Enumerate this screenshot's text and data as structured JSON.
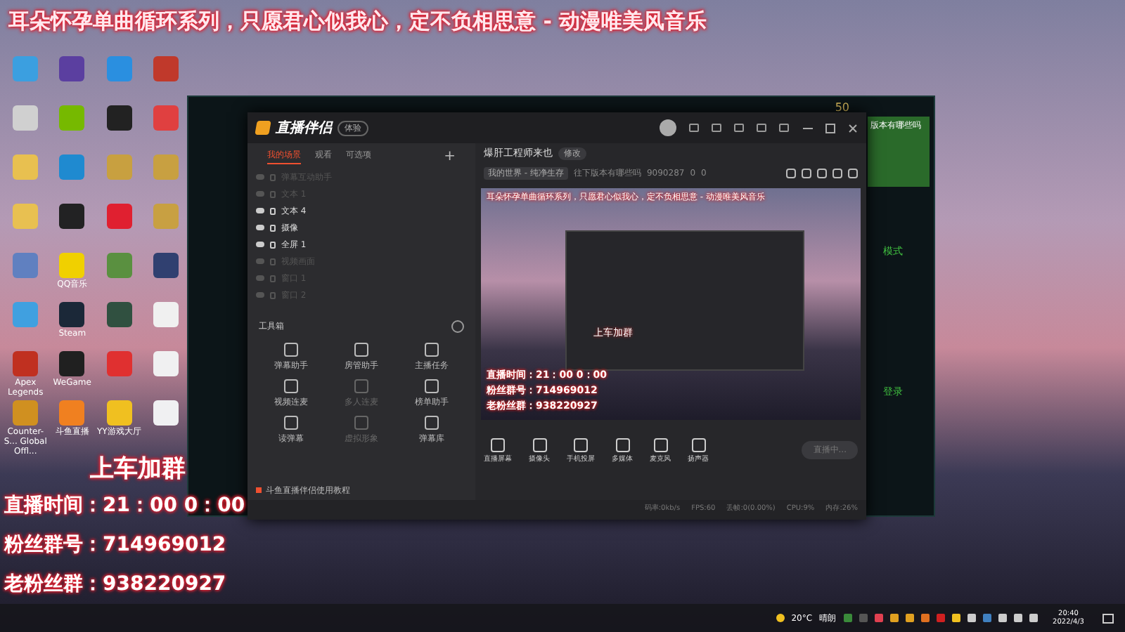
{
  "overlay": {
    "banner": "耳朵怀孕单曲循环系列，只愿君心似我心，定不负相思意 - 动漫唯美风音乐",
    "join": "上车加群",
    "lines": [
      "直播时间：21：00 0：00",
      "粉丝群号：714969012",
      "老粉丝群：938220927"
    ]
  },
  "desktop_icons": [
    {
      "color": "#3b9fe0"
    },
    {
      "color": "#5b3fa0"
    },
    {
      "color": "#2a8fe0"
    },
    {
      "color": "#c0392b"
    },
    {
      "color": "#d0d0d0"
    },
    {
      "color": "#76b900"
    },
    {
      "color": "#222222"
    },
    {
      "color": "#e04040"
    },
    {
      "color": "#e8c050"
    },
    {
      "color": "#1f8ad0"
    },
    {
      "color": "#c8a040"
    },
    {
      "color": "#c8a041"
    },
    {
      "color": "#e8c051"
    },
    {
      "color": "#222223"
    },
    {
      "color": "#e02030"
    },
    {
      "color": "#c8a042"
    },
    {
      "color": "#6080c0"
    },
    {
      "label": "QQ音乐",
      "color": "#f0d000"
    },
    {
      "color": "#5a9040"
    },
    {
      "color": "#304070"
    },
    {
      "color": "#40a0e0"
    },
    {
      "label": "Steam",
      "color": "#1b2838"
    },
    {
      "color": "#305040"
    },
    {
      "color": "#f0f0f0"
    },
    {
      "label": "Apex Legends",
      "color": "#c03020"
    },
    {
      "label": "WeGame",
      "color": "#202020"
    },
    {
      "color": "#e03030"
    },
    {
      "color": "#f0f0f1"
    },
    {
      "label": "Counter-S... Global Offl...",
      "color": "#d09020"
    },
    {
      "label": "斗鱼直播",
      "color": "#f08020"
    },
    {
      "label": "YY游戏大厅",
      "color": "#f0c020"
    },
    {
      "color": "#f0f0f2"
    }
  ],
  "game_client": {
    "coins": "50",
    "notice": "版本有哪些吗",
    "labels": [
      "模式",
      "登录"
    ]
  },
  "app": {
    "title": "直播伴侣",
    "badge": "体验",
    "tabs": [
      {
        "label": "我的场景",
        "selected": true
      },
      {
        "label": "观看",
        "selected": false
      },
      {
        "label": "可选项",
        "selected": false
      }
    ],
    "add": "+",
    "layers": [
      {
        "name": "弹幕互动助手",
        "visible": false
      },
      {
        "name": "文本 1",
        "visible": false
      },
      {
        "name": "文本 4",
        "visible": true
      },
      {
        "name": "摄像",
        "visible": true
      },
      {
        "name": "全屏 1",
        "visible": true
      },
      {
        "name": "视频画面",
        "visible": false
      },
      {
        "name": "窗口 1",
        "visible": false
      },
      {
        "name": "窗口 2",
        "visible": false
      }
    ],
    "toolbox": "工具箱",
    "tools": [
      {
        "label": "弹幕助手",
        "disabled": false
      },
      {
        "label": "房管助手",
        "disabled": false
      },
      {
        "label": "主播任务",
        "disabled": false
      },
      {
        "label": "视频连麦",
        "disabled": false
      },
      {
        "label": "多人连麦",
        "disabled": true
      },
      {
        "label": "榜单助手",
        "disabled": false
      },
      {
        "label": "读弹幕",
        "disabled": false
      },
      {
        "label": "虚拟形象",
        "disabled": true
      },
      {
        "label": "弹幕库",
        "disabled": false
      }
    ],
    "tutorial": "斗鱼直播伴侣使用教程",
    "room_title": "爆肝工程师来也",
    "edit": "修改",
    "category": "我的世界 - 纯净生存",
    "room_info": "往下版本有哪些吗",
    "room_id": "9090287",
    "hot": "0",
    "viewers": "0",
    "preview": {
      "banner": "耳朵怀孕单曲循环系列，只愿君心似我心，定不负相思意 - 动漫唯美风音乐",
      "join": "上车加群",
      "lines": [
        "直播时间：21：00 0：00",
        "粉丝群号：714969012",
        "老粉丝群：938220927"
      ]
    },
    "sources": [
      "直播屏幕",
      "摄像头",
      "手机投屏",
      "多媒体",
      "麦克风",
      "扬声器"
    ],
    "live_button": "直播中...",
    "status": [
      "码率:0kb/s",
      "FPS:60",
      "丢帧:0(0.00%)",
      "CPU:9%",
      "内存:26%"
    ]
  },
  "taskbar": {
    "weather": "20°C",
    "condition": "晴朗",
    "time": "20:40",
    "date": "2022/4/3"
  }
}
